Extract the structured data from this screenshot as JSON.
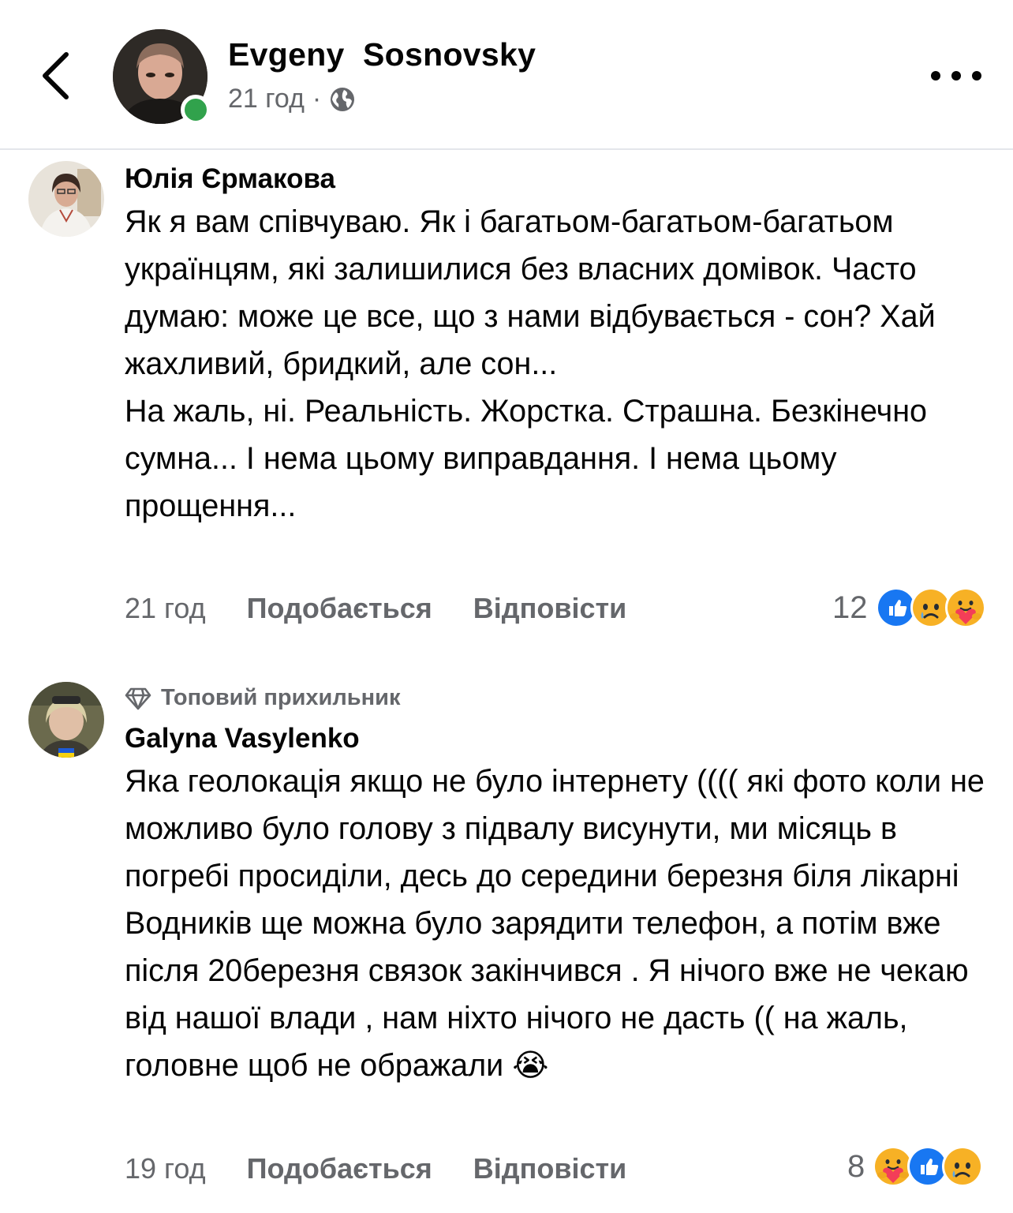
{
  "header": {
    "author_name": "Evgeny  Sosnovsky",
    "time": "21 год",
    "separator": "·",
    "icons": {
      "back": "chevron-left-icon",
      "privacy": "globe-icon",
      "more": "more-dots-icon"
    }
  },
  "comments": [
    {
      "name": "Юлія Єрмакова",
      "paragraphs": [
        "Як я вам співчуваю. Як і багатьом-багатьом-багатьом українцям, які залишилися без власних домівок. Часто думаю: може це все, що з нами відбувається - сон? Хай жахливий, бридкий, але сон...",
        "На жаль, ні. Реальність. Жорстка. Страшна. Безкінечно сумна... І нема цьому виправдання. І нема цьому прощення..."
      ],
      "time": "21 год",
      "like_label": "Подобається",
      "reply_label": "Відповісти",
      "reaction_count": "12",
      "reactions": [
        "like-icon",
        "sad-icon",
        "care-icon"
      ]
    },
    {
      "badge": "Топовий прихильник",
      "name": "Galyna Vasylenko",
      "text": "Яка геолокація якщо не було інтернету (((( які фото коли не можливо було голову з підвалу висунути, ми місяць в погребі просиділи, десь до середини березня біля лікарні Водників ще можна було зарядити телефон, а потім вже після 20березня связок закінчився . Я нічого вже не чекаю від нашої влади , нам ніхто нічого не дасть (( на жаль, головне щоб не ображали",
      "emoji": "😭",
      "time": "19 год",
      "like_label": "Подобається",
      "reply_label": "Відповісти",
      "reaction_count": "8",
      "reactions": [
        "care-icon",
        "like-icon",
        "sad-icon"
      ]
    }
  ],
  "colors": {
    "text": "#050505",
    "secondary": "#65676b",
    "online": "#31a24c",
    "like_blue": "#1877f2",
    "reaction_yellow": "#f7b125",
    "care_heart": "#f33e58",
    "divider": "#e4e6eb"
  }
}
